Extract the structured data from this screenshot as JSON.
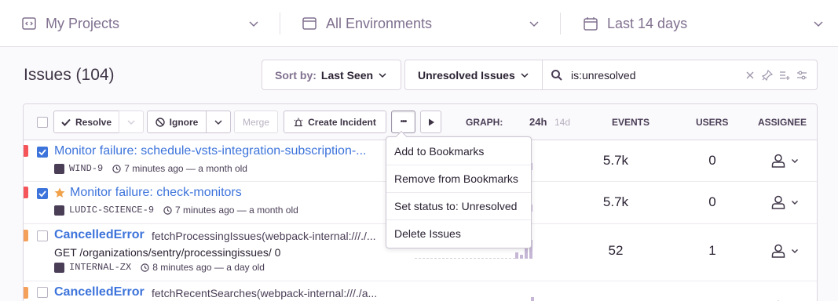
{
  "topbar": {
    "projects": "My Projects",
    "environments": "All Environments",
    "period": "Last 14 days"
  },
  "header": {
    "title": "Issues (104)",
    "sort_label": "Sort by:",
    "sort_value": "Last Seen",
    "saved_search": "Unresolved Issues",
    "search_query": "is:unresolved"
  },
  "toolbar": {
    "resolve": "Resolve",
    "ignore": "Ignore",
    "merge": "Merge",
    "create_incident": "Create Incident",
    "more": "•••",
    "graph_label": "GRAPH:",
    "graph_24h": "24h",
    "graph_14d": "14d",
    "events": "EVENTS",
    "users": "USERS",
    "assignee": "ASSIGNEE"
  },
  "colors": {
    "accent": "#3d74db",
    "level_error": "#f55459",
    "level_warning": "#f5a05a",
    "bookmark_star": "#f0a14a"
  },
  "issues": [
    {
      "title": "Monitor failure: schedule-vsts-integration-subscription-...",
      "short_id": "WIND-9",
      "time": "7 minutes ago — a month old",
      "events": "5.7k",
      "users": "0",
      "level_color": "#f55459",
      "checked": true,
      "bookmarked": false,
      "graph": [
        0.0,
        0.0,
        0.0,
        0.45
      ]
    },
    {
      "title": "Monitor failure: check-monitors",
      "short_id": "LUDIC-SCIENCE-9",
      "time": "7 minutes ago — a month old",
      "events": "5.7k",
      "users": "0",
      "level_color": "#f55459",
      "checked": true,
      "bookmarked": true,
      "graph": [
        0.0,
        0.0,
        0.0,
        0.45
      ]
    },
    {
      "title": "CancelledError",
      "culprit": "fetchProcessingIssues(webpack-internal:///./...",
      "message": "GET /organizations/sentry/processingissues/ 0",
      "short_id": "INTERNAL-ZX",
      "time": "8 minutes ago — a day old",
      "events": "52",
      "users": "1",
      "level_color": "#f5a05a",
      "checked": false,
      "bookmarked": false,
      "graph": [
        0.35,
        0.2,
        0.55,
        1.0
      ]
    },
    {
      "title": "CancelledError",
      "culprit": "fetchRecentSearches(webpack-internal:///./a...",
      "level_color": "#f5a05a",
      "checked": false
    }
  ],
  "menu": {
    "items": [
      "Add to Bookmarks",
      "Remove from Bookmarks",
      "Set status to: Unresolved",
      "Delete Issues"
    ]
  }
}
